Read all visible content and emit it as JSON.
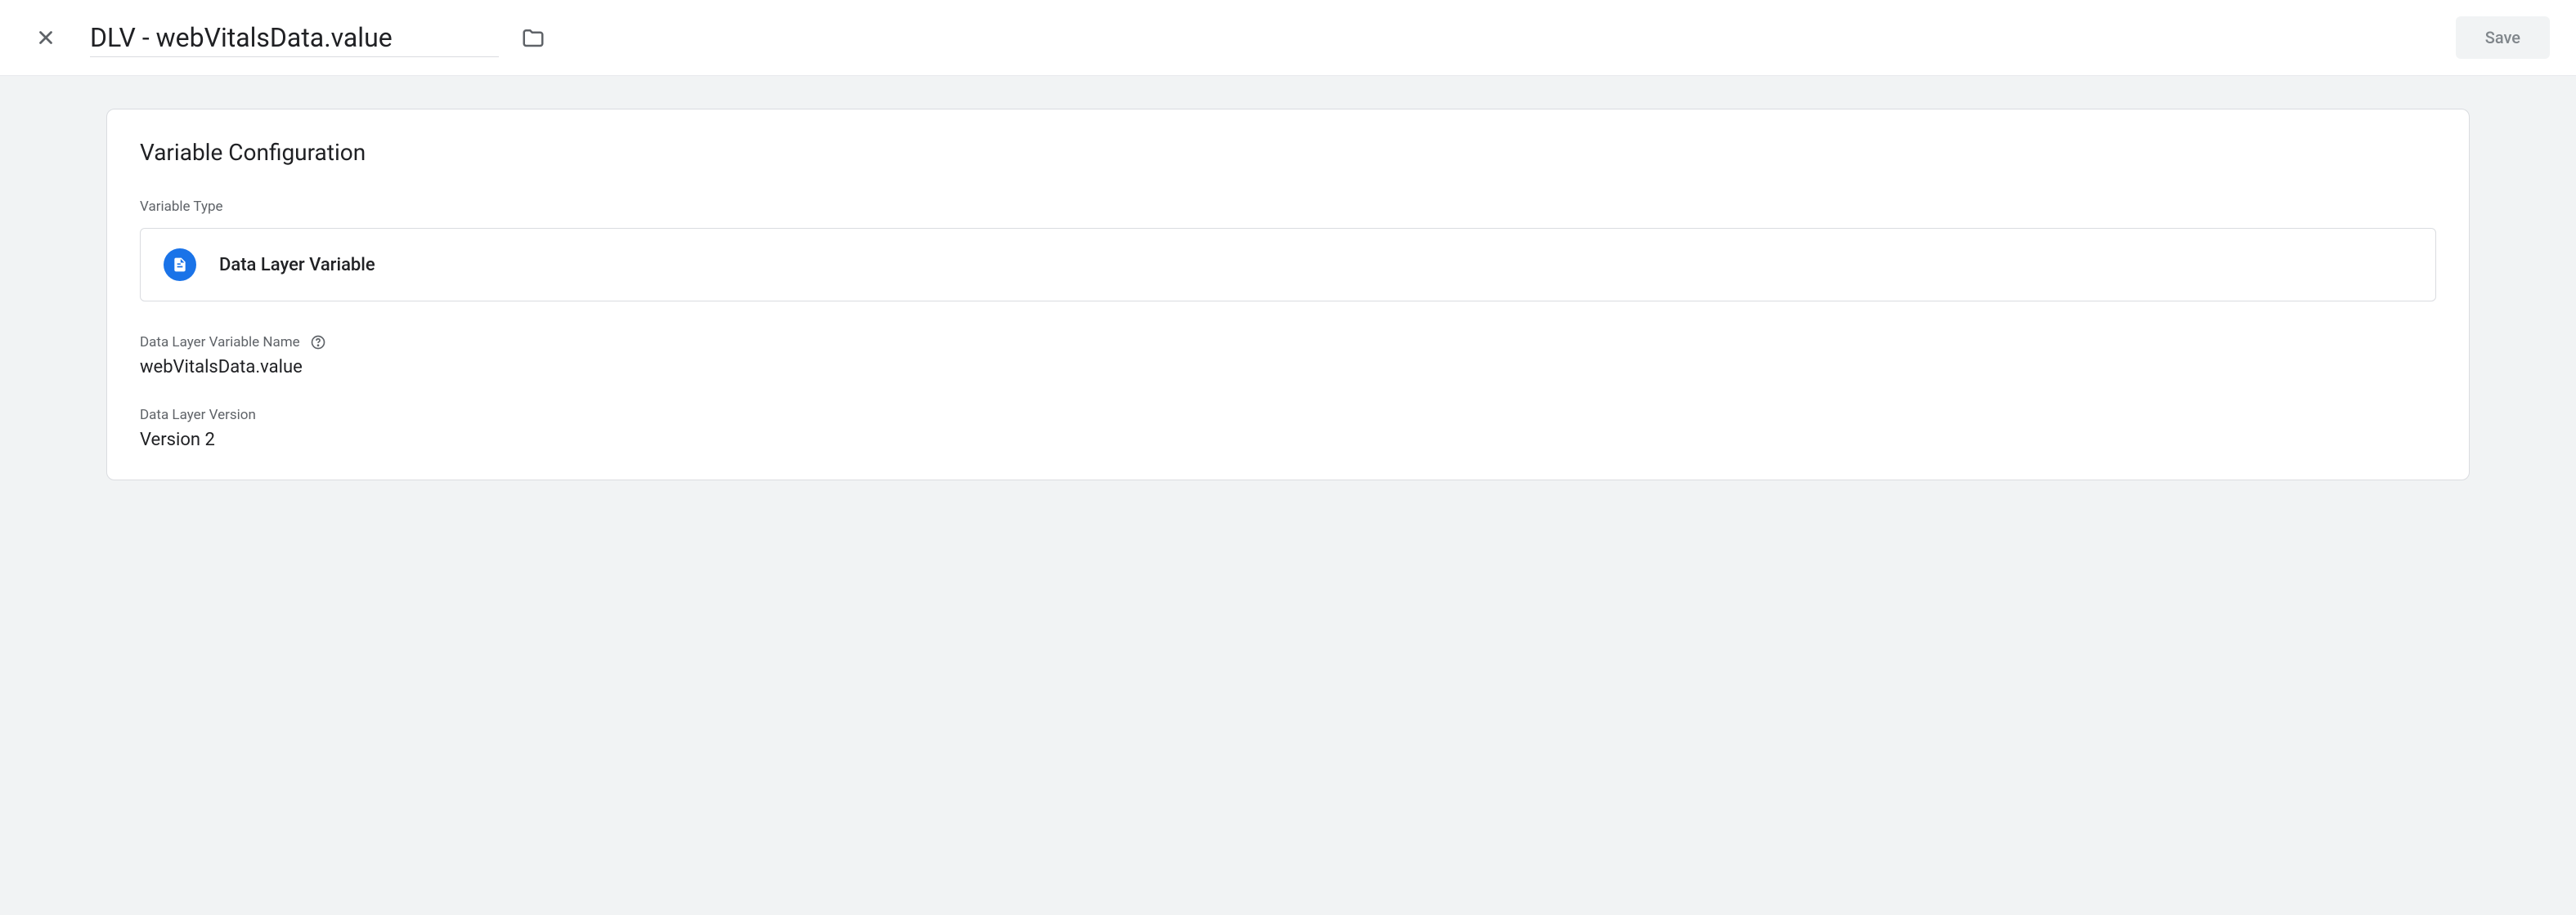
{
  "header": {
    "title": "DLV - webVitalsData.value",
    "save_label": "Save"
  },
  "panel": {
    "title": "Variable Configuration",
    "variable_type_label": "Variable Type",
    "variable_type_value": "Data Layer Variable",
    "variable_name_label": "Data Layer Variable Name",
    "variable_name_value": "webVitalsData.value",
    "version_label": "Data Layer Version",
    "version_value": "Version 2"
  }
}
